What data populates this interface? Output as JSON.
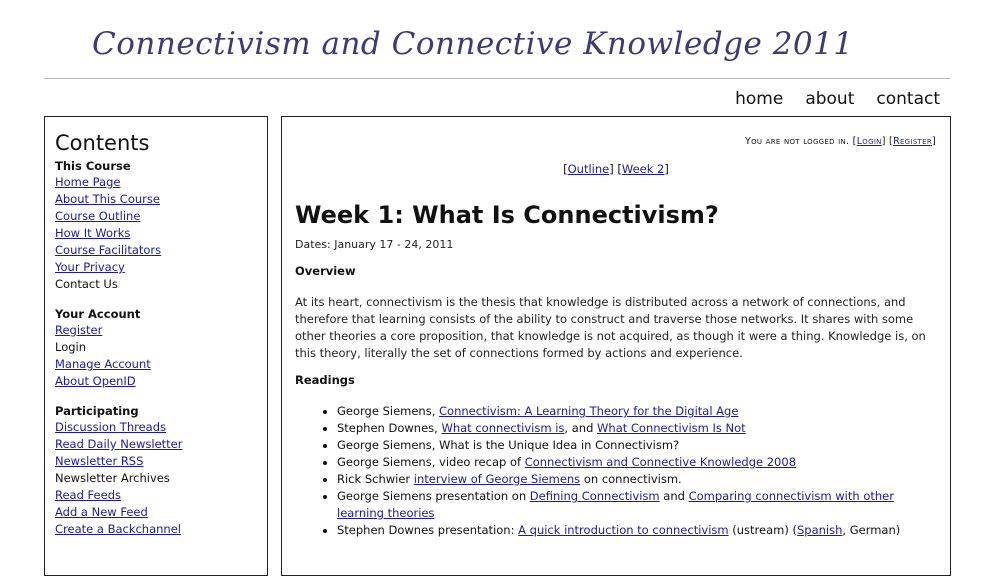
{
  "site": {
    "title": "Connectivism and Connective Knowledge 2011",
    "nav": [
      "home",
      "about",
      "contact"
    ]
  },
  "sidebar": {
    "heading": "Contents",
    "sections": [
      {
        "title": "This Course",
        "items": [
          {
            "label": "Home Page",
            "link": true
          },
          {
            "label": "About This Course",
            "link": true
          },
          {
            "label": "Course Outline",
            "link": true
          },
          {
            "label": "How It Works",
            "link": true
          },
          {
            "label": "Course Facilitators",
            "link": true
          },
          {
            "label": "Your Privacy",
            "link": true
          },
          {
            "label": "Contact Us",
            "link": false
          }
        ]
      },
      {
        "title": "Your Account",
        "items": [
          {
            "label": "Register",
            "link": true
          },
          {
            "label": "Login",
            "link": false
          },
          {
            "label": "Manage Account",
            "link": true
          },
          {
            "label": "About OpenID",
            "link": true
          }
        ]
      },
      {
        "title": "Participating",
        "items": [
          {
            "label": "Discussion Threads",
            "link": true
          },
          {
            "label": "Read Daily Newsletter",
            "link": true
          },
          {
            "label": "Newsletter RSS",
            "link": true
          },
          {
            "label": "Newsletter Archives",
            "link": false
          },
          {
            "label": "Read Feeds",
            "link": true
          },
          {
            "label": "Add a New Feed",
            "link": true
          },
          {
            "label": "Create a Backchannel",
            "link": true
          }
        ]
      }
    ]
  },
  "main": {
    "login_status": {
      "text": "You are not logged in.",
      "login": "Login",
      "register": "Register"
    },
    "breadcrumbs": [
      "Outline",
      "Week 2"
    ],
    "title": "Week 1: What Is Connectivism?",
    "dates": "Dates: January 17 - 24, 2011",
    "overview_heading": "Overview",
    "overview_text": "At its heart, connectivism is the thesis that knowledge is distributed across a network of connections, and therefore that learning consists of the ability to construct and traverse those networks. It shares with some other theories a core proposition, that knowledge is not acquired, as though it were a thing. Knowledge is, on this theory, literally the set of connections formed by actions and experience.",
    "readings_heading": "Readings",
    "readings": [
      {
        "parts": [
          {
            "t": "George Siemens, "
          },
          {
            "t": "Connectivism: A Learning Theory for the Digital Age",
            "link": true
          }
        ]
      },
      {
        "parts": [
          {
            "t": "Stephen Downes, "
          },
          {
            "t": "What connectivism is",
            "link": true
          },
          {
            "t": ", and "
          },
          {
            "t": "What Connectivism Is Not",
            "link": true
          }
        ]
      },
      {
        "parts": [
          {
            "t": "George Siemens, What is the Unique Idea in Connectivism?"
          }
        ]
      },
      {
        "parts": [
          {
            "t": "George Siemens, video recap of "
          },
          {
            "t": "Connectivism and Connective Knowledge 2008",
            "link": true
          }
        ]
      },
      {
        "parts": [
          {
            "t": "Rick Schwier "
          },
          {
            "t": "interview of George Siemens",
            "link": true
          },
          {
            "t": " on connectivism."
          }
        ]
      },
      {
        "parts": [
          {
            "t": "George Siemens presentation on "
          },
          {
            "t": "Defining Connectivism",
            "link": true
          },
          {
            "t": " and "
          },
          {
            "t": "Comparing connectivism with other learning theories",
            "link": true
          }
        ]
      },
      {
        "parts": [
          {
            "t": "Stephen Downes presentation: "
          },
          {
            "t": "A quick introduction to connectivism",
            "link": true
          },
          {
            "t": " (ustream) ("
          },
          {
            "t": "Spanish",
            "link": true
          },
          {
            "t": ", German)"
          }
        ]
      }
    ]
  }
}
